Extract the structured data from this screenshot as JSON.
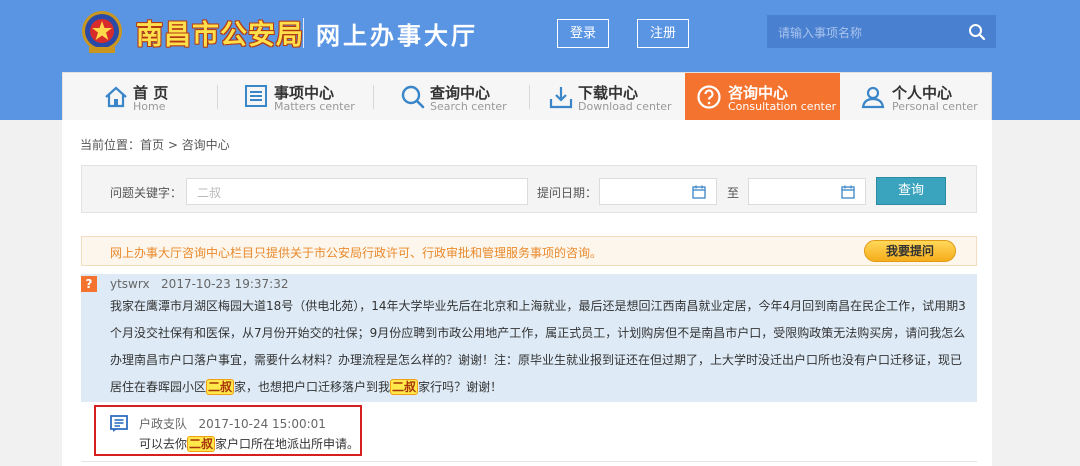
{
  "header": {
    "brand": "南昌市公安局",
    "hall": "网上办事大厅",
    "login_label": "登录",
    "register_label": "注册",
    "search_placeholder": "请输入事项名称",
    "bg_color": "#5a95e4",
    "brand_color": "#ffe04c"
  },
  "nav": {
    "items": [
      {
        "zh": "首 页",
        "en": "Home",
        "icon": "home-icon"
      },
      {
        "zh": "事项中心",
        "en": "Matters center",
        "icon": "list-icon"
      },
      {
        "zh": "查询中心",
        "en": "Search center",
        "icon": "search-icon"
      },
      {
        "zh": "下载中心",
        "en": "Download center",
        "icon": "download-icon"
      },
      {
        "zh": "咨询中心",
        "en": "Consultation center",
        "icon": "question-icon",
        "active": true
      },
      {
        "zh": "个人中心",
        "en": "Personal center",
        "icon": "user-icon"
      }
    ],
    "active_color": "#f4732e"
  },
  "breadcrumb": "当前位置：首页 > 咨询中心",
  "filter": {
    "keyword_label": "问题关键字：",
    "keyword_value": "二叔",
    "date_label": "提问日期：",
    "to_label": "至",
    "query_label": "查询"
  },
  "notice": {
    "text": "网上办事大厅咨询中心栏目只提供关于市公安局行政许可、行政审批和管理服务事项的咨询。",
    "ask_label": "我要提问"
  },
  "question": {
    "user": "ytswrx",
    "time": "2017-10-23 19:37:32",
    "body_part1": "我家在鹰潭市月湖区梅园大道18号（供电北苑），14年大学毕业先后在北京和上海就业，最后还是想回江西南昌就业定居，今年4月回到南昌在民企工作，试用期3个月没交社保有和医保，从7月份开始交的社保；9月份应聘到市政公用地产工作，属正式员工，计划购房但不是南昌市户口，受限购政策无法购买房，请问我怎么办理南昌市户口落户事宜，需要什么材料？办理流程是怎么样的？谢谢！注：原毕业生就业报到证还在但过期了，上大学时没迁出户口所也没有户口迁移证，现已居住在春晖园小区",
    "highlight1": "二叔",
    "body_part2": "家，也想把户口迁移落户到我",
    "highlight2": "二叔",
    "body_part3": "家行吗？谢谢！"
  },
  "answer": {
    "author": "户政支队",
    "time": "2017-10-24 15:00:01",
    "text_part1": "可以去你",
    "highlight": "二叔",
    "text_part2": "家户口所在地派出所申请。"
  }
}
